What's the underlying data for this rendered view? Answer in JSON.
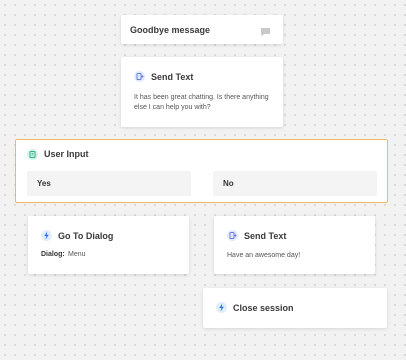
{
  "goodbye": {
    "title": "Goodbye message",
    "icon": "chat-bubble-icon"
  },
  "send_text_1": {
    "title": "Send Text",
    "body": "It has been great chatting. Is there anything else I can help you with?",
    "icon": "send-text-icon"
  },
  "user_input": {
    "title": "User Input",
    "icon": "user-input-icon",
    "options": [
      "Yes",
      "No"
    ],
    "accent_color": "#f0b96a"
  },
  "go_to_dialog": {
    "title": "Go To Dialog",
    "field_label": "Dialog:",
    "field_value": "Menu",
    "icon": "lightning-icon"
  },
  "send_text_2": {
    "title": "Send Text",
    "body": "Have an awesome day!",
    "icon": "send-text-icon"
  },
  "close_session": {
    "title": "Close session",
    "icon": "lightning-icon"
  }
}
